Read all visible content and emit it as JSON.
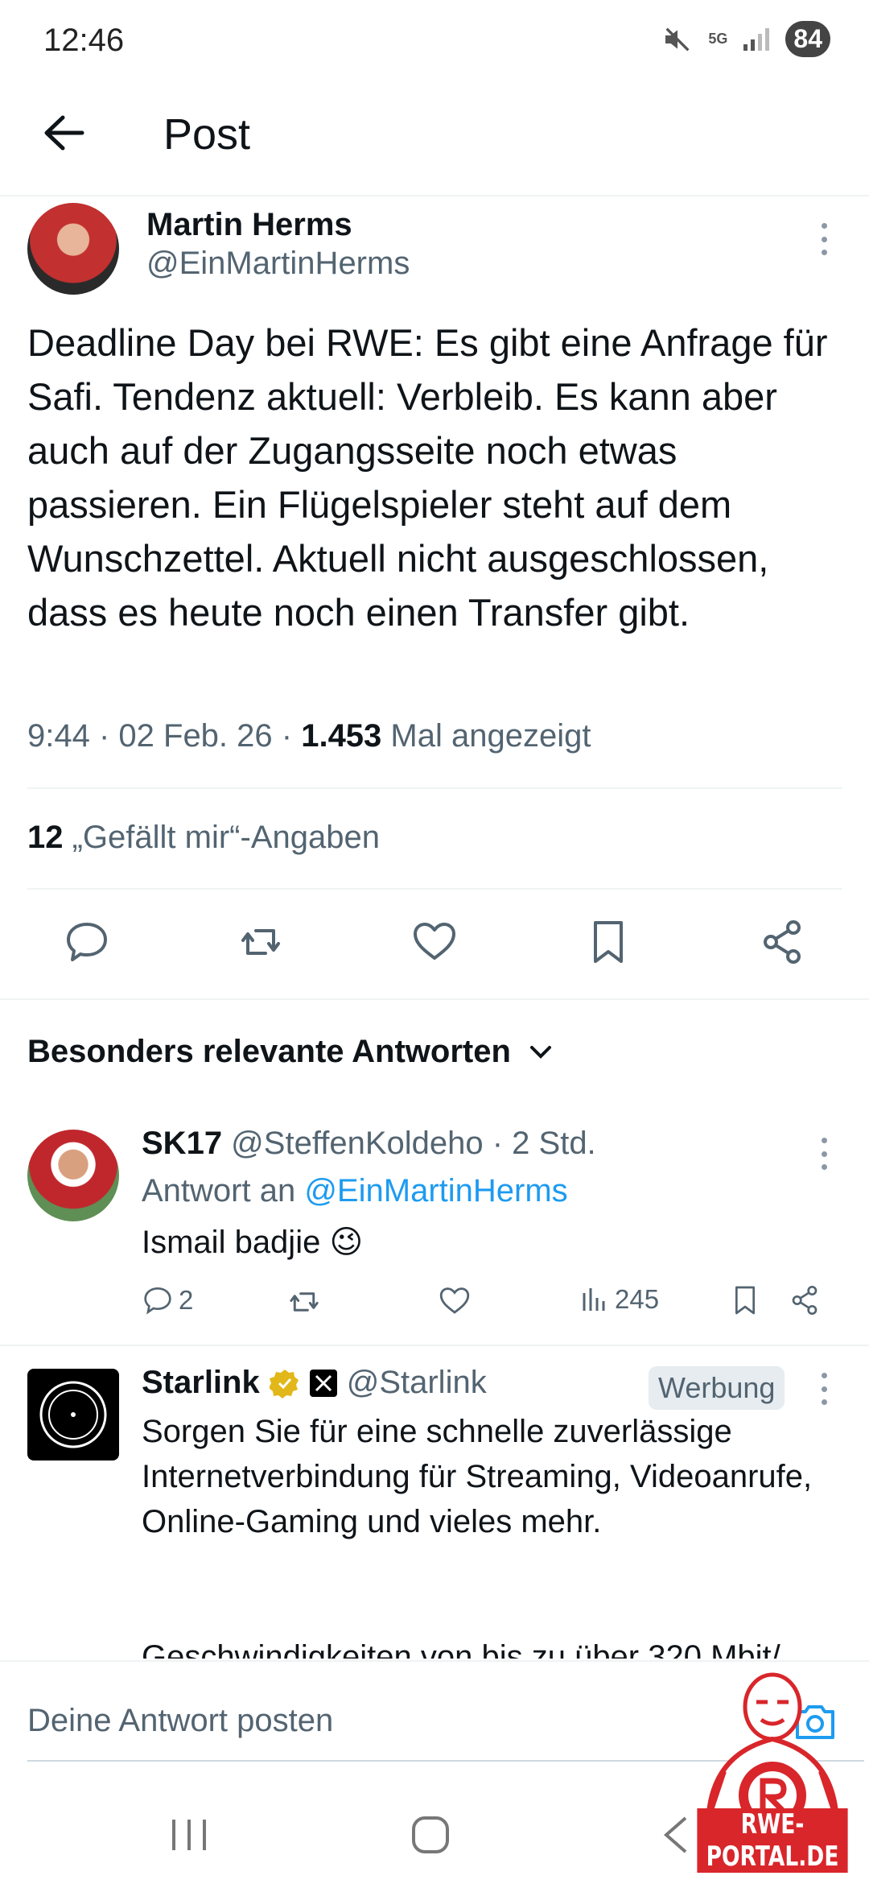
{
  "status_bar": {
    "time": "12:46",
    "network": "5G",
    "battery": "84"
  },
  "header": {
    "title": "Post"
  },
  "post": {
    "author_name": "Martin Herms",
    "author_handle": "@EinMartinHerms",
    "text": "Deadline Day bei RWE: Es gibt eine Anfrage für Safi. Tendenz aktuell: Verbleib. Es kann aber auch auf der Zugangsseite noch etwas passieren. Ein Flügelspieler steht auf dem Wunschzettel. Aktuell nicht ausgeschlossen, dass es heute noch einen Transfer gibt.",
    "timestamp": "9:44 · 02 Feb. 26 · ",
    "views_count": "1.453",
    "views_label": " Mal angezeigt",
    "likes_count": "12",
    "likes_label": " „Gefällt mir“-Angaben"
  },
  "replies_section": {
    "heading": "Besonders relevante Antworten"
  },
  "reply": {
    "name": "SK17",
    "handle_time": " @SteffenKoldeho · 2 Std.",
    "reply_to_label": "Antwort an ",
    "reply_to_handle": "@EinMartinHerms",
    "text": "Ismail badjie 😉",
    "reply_count": "2",
    "views": "245"
  },
  "ad": {
    "name": "Starlink",
    "handle": "@Starlink",
    "badge": "Werbung",
    "text": "Sorgen Sie für eine schnelle zuverlässige Internetverbindung für Streaming, Videoanrufe, Online-Gaming und vieles mehr.",
    "text_cut": "Geschwindigkeiten von bis zu über 320 Mbit/"
  },
  "composer": {
    "placeholder": "Deine Antwort posten"
  },
  "watermark": {
    "text": "RWE-PORTAL.DE"
  },
  "icons": {
    "back": "arrow-left-icon",
    "more": "more-vertical-icon",
    "reply": "comment-icon",
    "repost": "repost-icon",
    "like": "heart-icon",
    "bookmark": "bookmark-icon",
    "share": "share-icon",
    "chevron": "chevron-down-icon",
    "views": "bar-chart-icon",
    "verified": "verified-badge-icon",
    "camera": "camera-icon"
  },
  "colors": {
    "accent": "#1d9bf0",
    "secondary_text": "#536471",
    "verified": "#e2b719"
  }
}
